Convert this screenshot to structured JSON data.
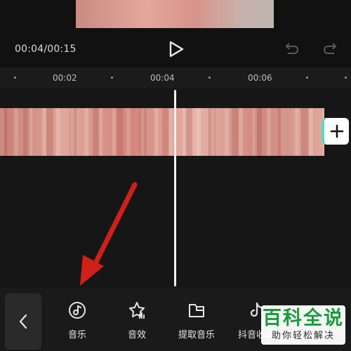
{
  "player": {
    "timecode": "00:04/00:15"
  },
  "ruler": {
    "ticks": [
      "00:02",
      "00:04",
      "00:06"
    ]
  },
  "timeline": {
    "add_label": "+"
  },
  "toolbar": {
    "items": [
      {
        "label": "音乐",
        "icon": "music-note-icon"
      },
      {
        "label": "音效",
        "icon": "sound-effect-star-icon"
      },
      {
        "label": "提取音乐",
        "icon": "folder-icon"
      },
      {
        "label": "抖音收藏",
        "icon": "douyin-icon"
      }
    ]
  },
  "watermark": {
    "title": "百科全说",
    "subtitle": "助你轻松解决"
  },
  "colors": {
    "background": "#111111",
    "annotation_arrow": "#d0201a",
    "watermark_green": "#1b9b3a"
  }
}
